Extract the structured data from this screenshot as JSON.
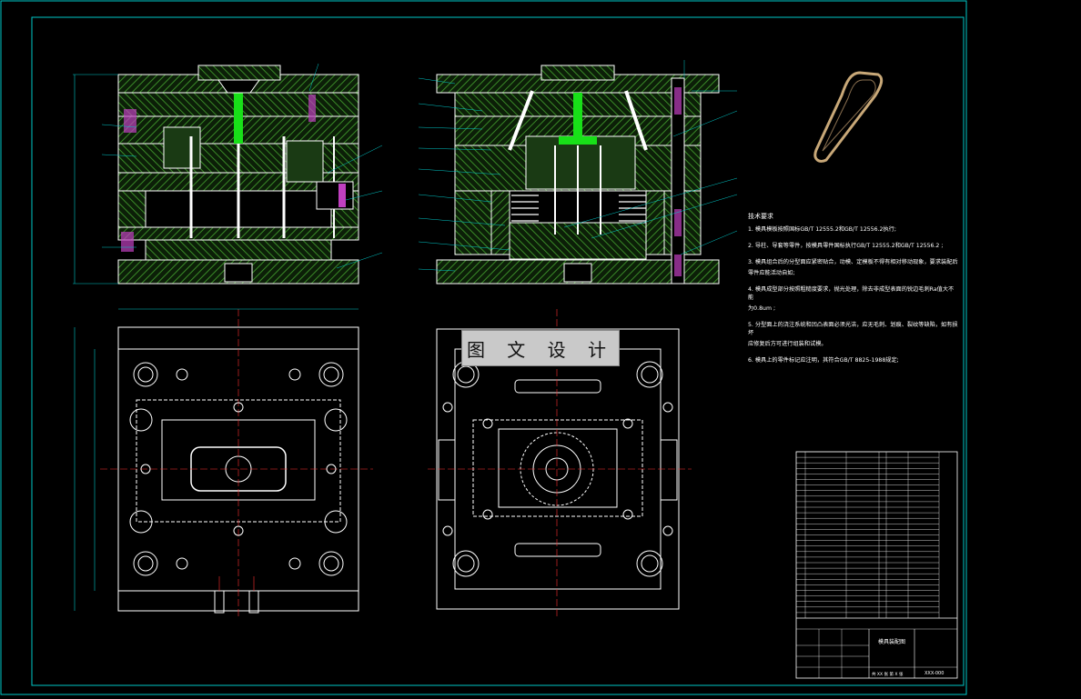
{
  "watermark": "图 文 设 计",
  "tech_notes": {
    "title": "技术要求",
    "items": [
      "1. 模具模板按照国标GB/T 12555.2和GB/T 12556.2执行;",
      "2. 导柱、导套等零件，按模具零件国标执行GB/T 12555.2和GB/T 12556.2 ;",
      "3. 模具组合后的分型面应紧密贴合，动模、定模板不得有相对移动现象，要求装配后",
      "   零件应能活动自如;",
      "4. 模具成型部分按照粗糙度要求，抛光处理，除去非成型表面的锐边毛刺Ra值大不能",
      "   为0.8um ;",
      "5. 分型面上的浇注系统和凹凸表面必须光洁，应无毛刺、划痕、裂纹等缺陷，如有损坏",
      "   应修复后方可进行组装和试模。",
      "6. 模具上的零件标记应注明，其符合GB/T 8825-1988规定;"
    ]
  },
  "title_block": {
    "drawing_title": "模具装配图",
    "drawing_number": "XXX-000",
    "scale_line": "共 XX 张 第 X 张"
  },
  "colors": {
    "background": "#000000",
    "frame": "#00c8c8",
    "outline": "#ffffff",
    "hatch": "#2f7a20",
    "sprue": "#18e018",
    "center_line": "#ff3030",
    "leader": "#00c8c8",
    "part": "#c8a878",
    "pin": "#c040c0"
  }
}
